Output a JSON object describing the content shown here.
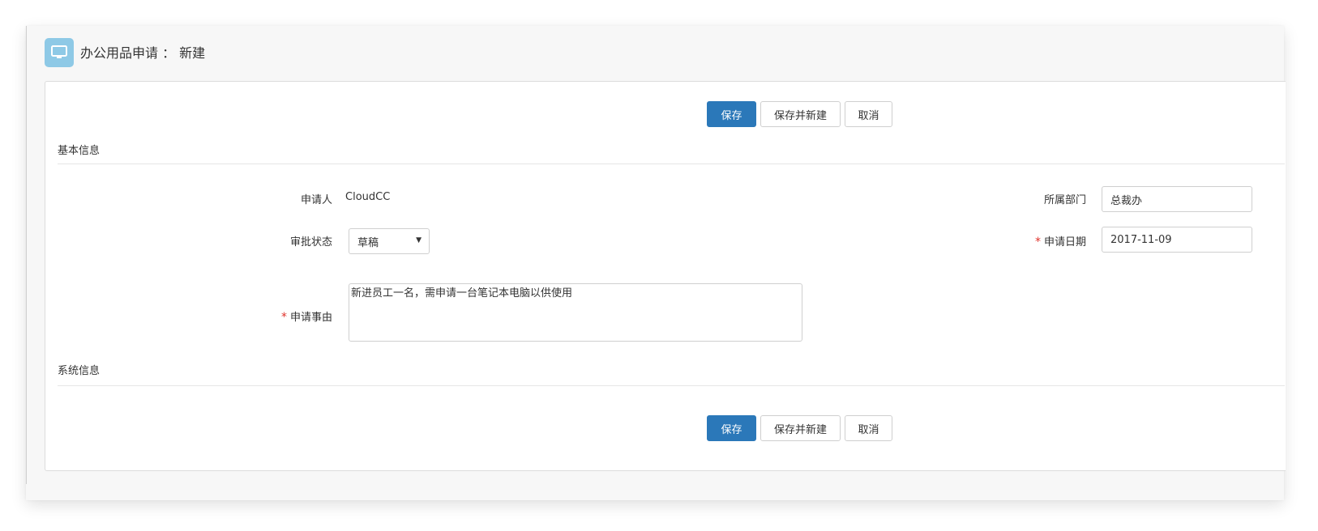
{
  "header": {
    "title": "办公用品申请 ： 新建",
    "icon": "monitor-icon"
  },
  "toolbar_top": {
    "save": "保存",
    "save_new": "保存并新建",
    "cancel": "取消"
  },
  "section_basic": {
    "title": "基本信息"
  },
  "form": {
    "applicant": {
      "label": "申请人",
      "value": "CloudCC"
    },
    "department": {
      "label": "所属部门",
      "value": "总裁办"
    },
    "status": {
      "label": "审批状态",
      "value": "草稿"
    },
    "apply_date": {
      "label": "申请日期",
      "value": "2017-11-09"
    },
    "reason": {
      "label": "申请事由",
      "value": "新进员工一名，需申请一台笔记本电脑以供使用"
    },
    "required_mark": "*"
  },
  "section_system": {
    "title": "系统信息"
  },
  "toolbar_bottom": {
    "save": "保存",
    "save_new": "保存并新建",
    "cancel": "取消"
  },
  "colors": {
    "primary": "#2b78b9",
    "required": "#e0322b",
    "icon_bg": "#8ec9e6"
  }
}
